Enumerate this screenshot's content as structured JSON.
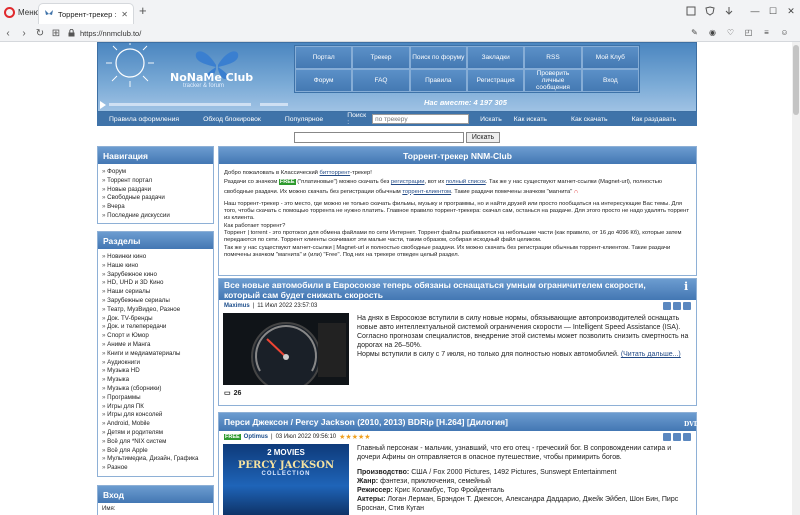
{
  "browser": {
    "menu_label": "Меню",
    "tab_title": "Торрент-трекер :: NNM-C",
    "url": "https://nnmclub.to/"
  },
  "header": {
    "logo_text": "NoNaMe Club",
    "logo_sub": "tracker & forum",
    "online_label": "Нас вместе:",
    "online_count": "4 197 305",
    "nav": [
      "Портал",
      "Трекер",
      "Поиск по форуму",
      "Закладки",
      "RSS",
      "Мой Клуб",
      "Форум",
      "FAQ",
      "Правила",
      "Регистрация",
      "Проверить личные сообщения",
      "Вход"
    ]
  },
  "links": {
    "rules": "Правила оформления",
    "bypass": "Обход блокировок",
    "popular": "Популярное",
    "search_label": "Поиск :",
    "search_placeholder": "по трекеру",
    "search_btn": "Искать",
    "how_search": "Как искать",
    "how_download": "Как скачать",
    "how_seed": "Как раздавать",
    "thanks": "Спасибо!"
  },
  "search2": {
    "btn": "Искать"
  },
  "navigation": {
    "title": "Навигация",
    "items": [
      "Форум",
      "Торрент портал",
      "Новые раздачи",
      "Свободные раздачи",
      "Вчера",
      "Последние дискуссии"
    ]
  },
  "sections": {
    "title": "Разделы",
    "items": [
      "Новинки кино",
      "Наше кино",
      "Зарубежное кино",
      "HD, UHD и 3D Кино",
      "Наши сериалы",
      "Зарубежные сериалы",
      "Театр, МузВидео, Разное",
      "Док. TV-бренды",
      "Док. и телепередачи",
      "Спорт и Юмор",
      "Аниме и Манга",
      "Книги и медиаматериалы",
      "Аудиокниги",
      "Музыка HD",
      "Музыка",
      "Музыка (сборники)",
      "Программы",
      "Игры для ПК",
      "Игры для консолей",
      "Android, Mobile",
      "Детям и родителям",
      "Всё для *NIX систем",
      "Всё для Apple",
      "Мультимедиа, Дизайн, Графика",
      "Разное"
    ]
  },
  "login": {
    "title": "Вход",
    "user_label": "Имя:"
  },
  "welcome": {
    "title": "Торрент-трекер NNM-Club",
    "l1a": "Добро пожаловать в Классический ",
    "l1b": "битторрент",
    "l1c": "-трекер!",
    "l2a": "Раздачи со значком ",
    "free": "FREE",
    "l2b": " (\"платиновые\") можно скачать без ",
    "reg": "регистрации",
    "l2c": ", вот их ",
    "full": "полный список",
    "l2d": ". Так же у нас существуют магнет-ссылки (Magnet-url), полностью",
    "l3a": "свободные раздачи. Их можно скачать без регистрации обычным ",
    "client": "торрент-клиентом",
    "l3b": ". Такие раздачи помечены значком \"магнита\"",
    "p2": "Наш торрент-трекер - это место, где можно не только скачать фильмы, музыку и программы, но и найти друзей или просто пообщаться на интересующие Вас темы. Для того, чтобы скачать с помощью торрента не нужно платить. Главное правило торрент-трекера: скачал сам, останься на раздаче. Для этого просто не надо удалять торрент из клиента.",
    "p3": "Как работает торрент?",
    "p4": "Торрент | torrent - это протокол для обмена файлами по сети Интернет. Торрент файлы разбиваются на небольшие части (как правило, от 16 до 4096 Кб), которые затем передаются по сети. Торрент клиенты скачивают эти малые части, таким образом, собирая исходный файл целиком.",
    "p5": "Так же у нас существуют магнет-ссылки | Magnet-url и полностью свободные раздачи. Их можно скачать без регистрации обычным торрент-клиентом. Такие раздачи помечены значком \"магнита\" и (или) \"Free\". Под них на трекере отведен целый раздел."
  },
  "news1": {
    "title": "Все новые автомобили в Евросоюзе теперь обязаны оснащаться умным ограничителем скорости, который сам будет снижать скорость",
    "author": "Maximus",
    "date": "11 Июл 2022 23:57:03",
    "p1": "На днях в Евросоюзе вступили в силу новые нормы, обязывающие автопроизводителей оснащать новые авто интеллектуальной системой ограничения скорости — Intelligent Speed Assistance (ISA). Согласно прогнозам специалистов, внедрение этой системы может позволить снизить смертность на дорогах на 26–50%.",
    "p2": "Нормы вступили в силу с 7 июля, но только для полностью новых автомобилей.",
    "more": "(Читать дальше...)",
    "comments": "26"
  },
  "news2": {
    "title": "Перси Джексон / Percy Jackson (2010, 2013) BDRip [H.264] [Дилогия]",
    "free": "FREE",
    "author": "Optimus",
    "date": "03 Июл 2022 09:56:10",
    "stars": "★★★★★",
    "desc": "Главный персонаж - мальчик, узнавший, что его отец - греческий бог. В сопровождении сатира и дочери Афины он отправляется в опасное путешествие, чтобы примирить богов.",
    "prod_l": "Производство:",
    "prod": " США / Fox 2000 Pictures, 1492 Pictures, Sunswept Entertainment",
    "genre_l": "Жанр:",
    "genre": " фэнтези, приключения, семейный",
    "dir_l": "Режиссер:",
    "dir": " Крис Коламбус, Тор Фройденталь",
    "cast_l": "Актеры:",
    "cast": " Логан Лерман, Брэндон Т. Джексон, Александра Даддарио, Джейк Эйбел, Шон Бин, Пирс Броснан, Стив Куган",
    "poster_top": "2 MOVIES",
    "poster_sub": "PERCY JACKSON",
    "poster_col": "COLLECTION"
  },
  "colors": {
    "header_blue": "#4b86c0",
    "bar_blue": "#3f73a9",
    "opera_red": "#e0292d",
    "free_green": "#2e9a2e",
    "star": "#f0a020"
  }
}
